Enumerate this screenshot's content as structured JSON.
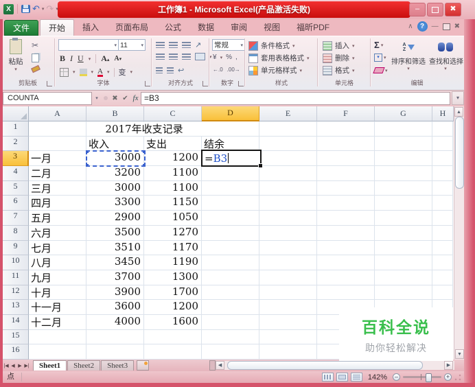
{
  "window": {
    "title": "工作簿1 - Microsoft Excel(产品激活失败)"
  },
  "tabs": {
    "file": "文件",
    "items": [
      "开始",
      "插入",
      "页面布局",
      "公式",
      "数据",
      "审阅",
      "视图",
      "福昕PDF"
    ],
    "active": "开始"
  },
  "ribbon": {
    "clipboard": {
      "label": "剪贴板",
      "paste": "粘贴"
    },
    "font": {
      "label": "字体",
      "size": "11",
      "phonetic": "变"
    },
    "alignment": {
      "label": "对齐方式"
    },
    "number": {
      "label": "数字",
      "format": "常规"
    },
    "styles": {
      "label": "样式",
      "conditional": "条件格式",
      "table": "套用表格格式",
      "cell": "单元格样式"
    },
    "cells": {
      "label": "单元格",
      "insert": "插入",
      "delete": "删除",
      "format": "格式"
    },
    "editing": {
      "label": "编辑",
      "sort": "排序和筛选",
      "find": "查找和选择"
    }
  },
  "formula_bar": {
    "name_box": "COUNTA",
    "formula": "=B3"
  },
  "grid": {
    "col_headers": [
      "A",
      "B",
      "C",
      "D",
      "E",
      "F",
      "G",
      "H"
    ],
    "row_count": 16,
    "selected_col_index": 3,
    "selected_row": 3,
    "title_text": "2017年收支记录",
    "column_titles": [
      {
        "col": 1,
        "text": "收入"
      },
      {
        "col": 2,
        "text": "支出"
      },
      {
        "col": 3,
        "text": "结余"
      }
    ],
    "first_month_row": 3,
    "months": [
      {
        "name": "一月",
        "income": "3000",
        "expense": "1200"
      },
      {
        "name": "二月",
        "income": "3200",
        "expense": "1100"
      },
      {
        "name": "三月",
        "income": "3000",
        "expense": "1100"
      },
      {
        "name": "四月",
        "income": "3300",
        "expense": "1150"
      },
      {
        "name": "五月",
        "income": "2900",
        "expense": "1050"
      },
      {
        "name": "六月",
        "income": "3500",
        "expense": "1270"
      },
      {
        "name": "七月",
        "income": "3510",
        "expense": "1170"
      },
      {
        "name": "八月",
        "income": "3450",
        "expense": "1190"
      },
      {
        "name": "九月",
        "income": "3700",
        "expense": "1300"
      },
      {
        "name": "十月",
        "income": "3900",
        "expense": "1700"
      },
      {
        "name": "十一月",
        "income": "3600",
        "expense": "1200"
      },
      {
        "name": "十二月",
        "income": "4000",
        "expense": "1600"
      }
    ],
    "edit_cell": {
      "ref": "D3",
      "prefix": "=",
      "reference": "B3"
    },
    "marching_cell": "B3"
  },
  "sheet_bar": {
    "tabs": [
      "Sheet1",
      "Sheet2",
      "Sheet3"
    ],
    "active_index": 0
  },
  "status_bar": {
    "mode": "点",
    "zoom_level": "142%"
  },
  "watermark": {
    "title": "百科全说",
    "subtitle": "助你轻松解决"
  },
  "colors": {
    "title_bar_red": "#d91212",
    "selection_orange": "#f9c03a",
    "formula_ref_blue": "#1f50c8",
    "watermark_green": "#3abf4d"
  }
}
